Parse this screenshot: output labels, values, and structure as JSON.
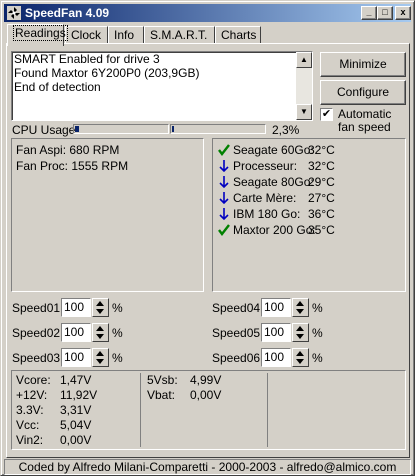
{
  "window": {
    "title": "SpeedFan 4.09",
    "minimize_glyph": "_",
    "maximize_glyph": "□",
    "close_glyph": "x"
  },
  "tabs": [
    {
      "label": "Readings",
      "active": true
    },
    {
      "label": "Clock",
      "active": false
    },
    {
      "label": "Info",
      "active": false
    },
    {
      "label": "S.M.A.R.T.",
      "active": false
    },
    {
      "label": "Charts",
      "active": false
    }
  ],
  "log": {
    "lines": [
      "SMART Enabled for drive 3",
      "Found Maxtor 6Y200P0 (203,9GB)",
      "End of detection"
    ]
  },
  "buttons": {
    "minimize": "Minimize",
    "configure": "Configure"
  },
  "auto_fan": {
    "label_line1": "Automatic",
    "label_line2": "fan speed",
    "checked": true,
    "check_glyph": "✔"
  },
  "cpu": {
    "label": "CPU Usage",
    "value": "2,3%",
    "fraction": 0.023
  },
  "fans": [
    {
      "label": "Fan Aspi:",
      "value": "680 RPM"
    },
    {
      "label": "Fan Proc:",
      "value": "1555 RPM"
    }
  ],
  "temps": [
    {
      "name": "Seagate 60Go:",
      "value": "32°C",
      "icon": "check-icon"
    },
    {
      "name": "Processeur:",
      "value": "32°C",
      "icon": "arrow-down-icon"
    },
    {
      "name": "Seagate 80Go:",
      "value": "29°C",
      "icon": "arrow-down-icon"
    },
    {
      "name": "Carte Mère:",
      "value": "27°C",
      "icon": "arrow-down-icon"
    },
    {
      "name": "IBM 180 Go:",
      "value": "36°C",
      "icon": "arrow-down-icon"
    },
    {
      "name": "Maxtor 200 Go:",
      "value": "35°C",
      "icon": "check-icon"
    }
  ],
  "speeds": [
    {
      "label": "Speed01:",
      "value": "100",
      "unit": "%"
    },
    {
      "label": "Speed02:",
      "value": "100",
      "unit": "%"
    },
    {
      "label": "Speed03:",
      "value": "100",
      "unit": "%"
    },
    {
      "label": "Speed04:",
      "value": "100",
      "unit": "%"
    },
    {
      "label": "Speed05:",
      "value": "100",
      "unit": "%"
    },
    {
      "label": "Speed06:",
      "value": "100",
      "unit": "%"
    }
  ],
  "voltages_col1": [
    {
      "label": "Vcore:",
      "value": "1,47V"
    },
    {
      "label": "+12V:",
      "value": "11,92V"
    },
    {
      "label": "3.3V:",
      "value": "3,31V"
    },
    {
      "label": "Vcc:",
      "value": "5,04V"
    },
    {
      "label": "Vin2:",
      "value": "0,00V"
    }
  ],
  "voltages_col2": [
    {
      "label": "5Vsb:",
      "value": "4,99V"
    },
    {
      "label": "Vbat:",
      "value": "0,00V"
    }
  ],
  "status": {
    "text": "Coded by Alfredo Milani-Comparetti - 2000-2003 - alfredo@almico.com"
  },
  "colors": {
    "ok": "#008000",
    "down": "#0000c0",
    "cpu_bar": "#0a246a"
  }
}
